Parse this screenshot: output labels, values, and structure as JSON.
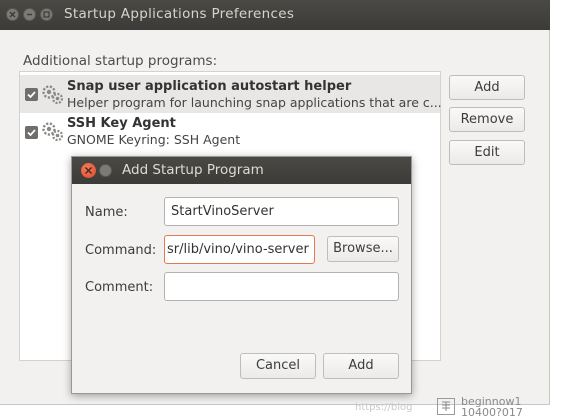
{
  "window": {
    "title": "Startup Applications Preferences",
    "section_label": "Additional startup programs:"
  },
  "programs": [
    {
      "title": "Snap user application autostart helper",
      "subtitle": "Helper program for launching snap applications that are c...",
      "checked": true,
      "selected": true
    },
    {
      "title": "SSH Key Agent",
      "subtitle": "GNOME Keyring: SSH Agent",
      "checked": true,
      "selected": false
    }
  ],
  "side_buttons": {
    "add": "Add",
    "remove": "Remove",
    "edit": "Edit"
  },
  "dialog": {
    "title": "Add Startup Program",
    "name_label": "Name:",
    "name_value": "StartVinoServer",
    "command_label": "Command:",
    "command_value": "sr/lib/vino/vino-server",
    "browse_label": "Browse...",
    "comment_label": "Comment:",
    "comment_value": "",
    "cancel_label": "Cancel",
    "add_label": "Add"
  },
  "watermark": {
    "url_fragment": "https://blog",
    "line1": "beginnow1",
    "line2": "10400?017"
  },
  "colors": {
    "titlebar": "#3c3b37",
    "close": "#df4b2a",
    "focus_border": "#e07a4f"
  }
}
